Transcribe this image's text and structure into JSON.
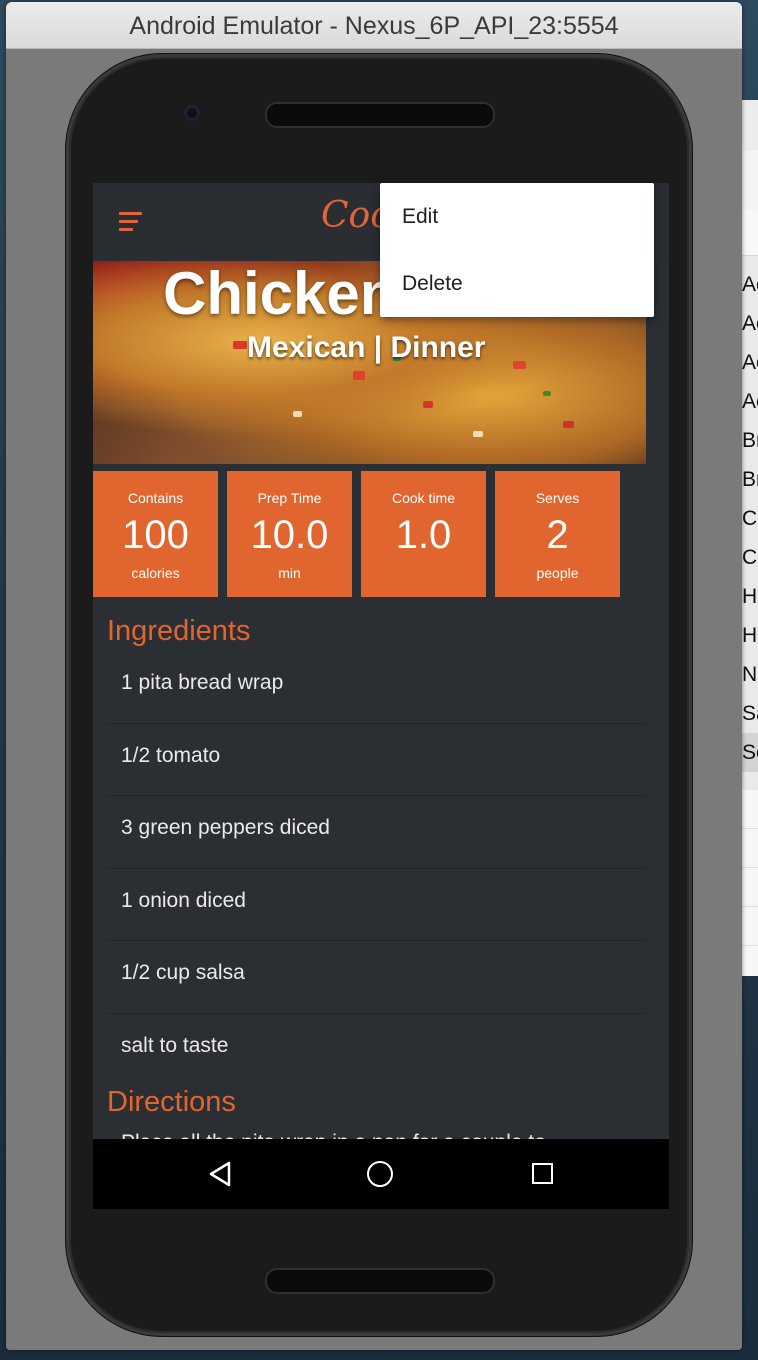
{
  "window": {
    "title": "Android Emulator - Nexus_6P_API_23:5554"
  },
  "background_window": {
    "rows": [
      "Ac",
      "Ac",
      "Ac",
      "Ac",
      "Br",
      "Br",
      "C",
      "C",
      "H",
      "H",
      "N",
      "Sa",
      "Se"
    ],
    "selected_index": 12
  },
  "app": {
    "title": "Cook",
    "menu_icon": "hamburger-menu-icon",
    "accent_color": "#e1652f"
  },
  "recipe": {
    "title": "Chicken",
    "subtitle": "Mexican | Dinner",
    "stats": [
      {
        "label": "Contains",
        "value": "100",
        "unit": "calories"
      },
      {
        "label": "Prep Time",
        "value": "10.0",
        "unit": "min"
      },
      {
        "label": "Cook time",
        "value": "1.0",
        "unit": ""
      },
      {
        "label": "Serves",
        "value": "2",
        "unit": "people"
      }
    ],
    "ingredients_title": "Ingredients",
    "ingredients": [
      "1 pita bread wrap",
      "1/2 tomato",
      "3 green peppers diced",
      "1 onion diced",
      "1/2 cup salsa",
      "salt to taste"
    ],
    "directions_title": "Directions",
    "directions_peek": "Place all the pita wrap in a pan for a couple to"
  },
  "popup_menu": {
    "items": [
      "Edit",
      "Delete"
    ]
  },
  "nav_bar": {
    "icons": [
      "back-icon",
      "home-icon",
      "recents-icon"
    ]
  }
}
